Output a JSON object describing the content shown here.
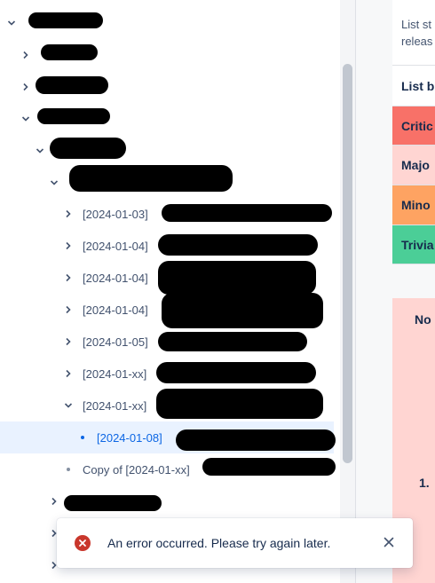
{
  "tree": {
    "items": [
      {
        "label": "",
        "expanded": true,
        "depth": 0
      },
      {
        "label": "",
        "expanded": false,
        "depth": 1
      },
      {
        "label": "",
        "expanded": false,
        "depth": 1
      },
      {
        "label": "",
        "expanded": true,
        "depth": 1
      },
      {
        "label": "",
        "expanded": true,
        "depth": 2
      },
      {
        "label": "",
        "expanded": true,
        "depth": 3
      },
      {
        "label": "[2024-01-03]",
        "expanded": false,
        "depth": 4
      },
      {
        "label": "[2024-01-04]",
        "expanded": false,
        "depth": 4
      },
      {
        "label": "[2024-01-04]",
        "expanded": false,
        "depth": 4
      },
      {
        "label": "[2024-01-04]",
        "expanded": false,
        "depth": 4
      },
      {
        "label": "[2024-01-05]",
        "expanded": false,
        "depth": 4
      },
      {
        "label": "[2024-01-xx]",
        "expanded": false,
        "depth": 4
      },
      {
        "label": "[2024-01-xx]",
        "expanded": true,
        "depth": 4
      },
      {
        "label": "[2024-01-08]",
        "leaf": true,
        "selected": true,
        "depth": 5
      },
      {
        "label": "Copy of [2024-01-xx]",
        "leaf": true,
        "depth": 4
      },
      {
        "label": "",
        "expanded": false,
        "depth": 2
      },
      {
        "label": "",
        "expanded": false,
        "depth": 2
      },
      {
        "label": "",
        "expanded": false,
        "depth": 2
      }
    ]
  },
  "content": {
    "info_line1": "List st",
    "info_line2": "releas",
    "header": "List b",
    "rows": [
      {
        "label": "Critic",
        "color": "#f87168"
      },
      {
        "label": "Majo",
        "color": "#ffd5d2"
      },
      {
        "label": "Mino",
        "color": "#fea362"
      },
      {
        "label": "Trivia",
        "color": "#4bce97"
      }
    ],
    "big_cell_title": "No",
    "big_cell_item": "1."
  },
  "toast": {
    "message": "An error occurred. Please try again later.",
    "icon": "error-icon",
    "close_icon": "close-icon"
  }
}
